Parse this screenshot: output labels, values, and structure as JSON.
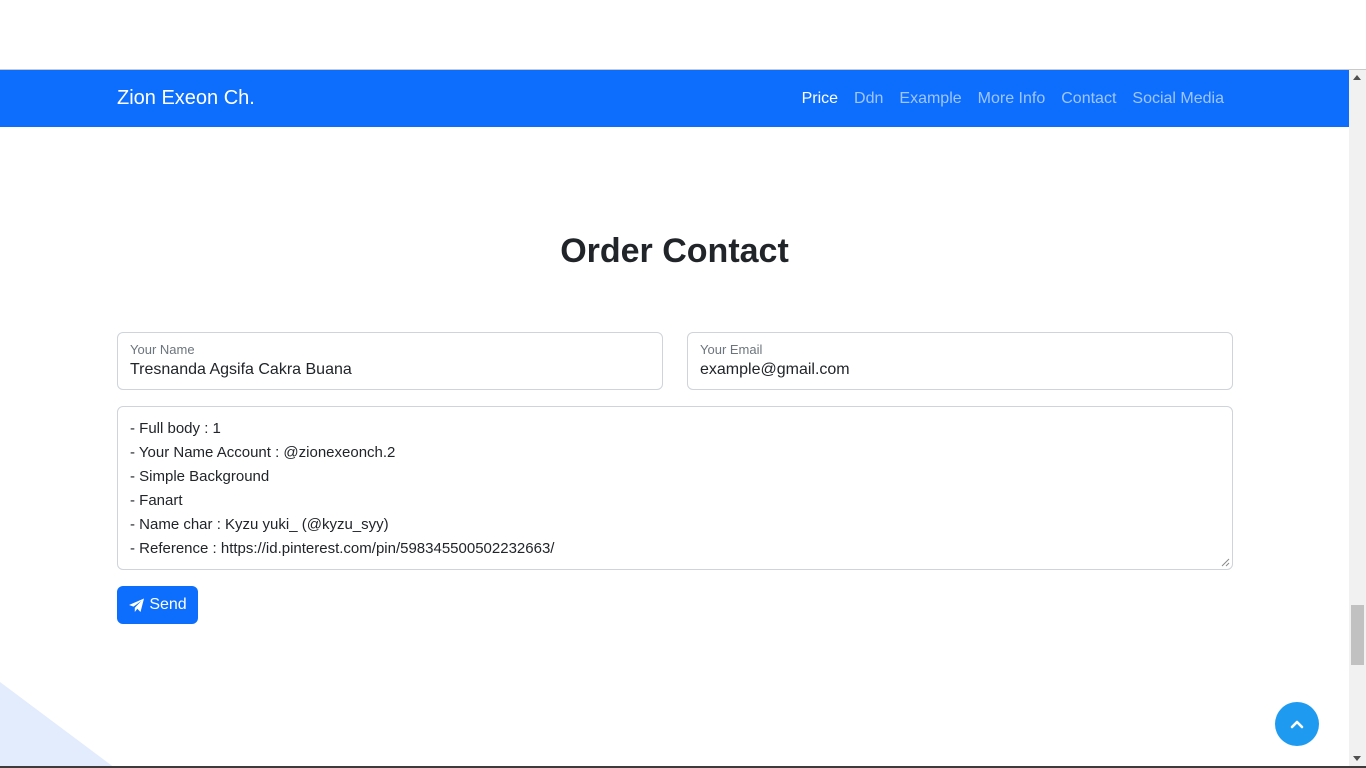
{
  "navbar": {
    "brand": "Zion Exeon Ch.",
    "links": [
      "Price",
      "Ddn",
      "Example",
      "More Info",
      "Contact",
      "Social Media"
    ],
    "active_link": "Price"
  },
  "form": {
    "title": "Order Contact",
    "name_label": "Your Name",
    "name_value": "Tresnanda Agsifa Cakra Buana",
    "email_label": "Your Email",
    "email_value": "example@gmail.com",
    "message_lines": [
      "- Full body : 1",
      "- Your Name Account : @zionexeonch.2",
      "- Simple Background",
      "- Fanart",
      "- Name char : Kyzu yuki_ (@kyzu_syy)",
      "- Reference : https://id.pinterest.com/pin/598345500502232663/"
    ],
    "send_label": "Send"
  },
  "icons": {
    "send": "paper-plane-icon",
    "scroll_top": "chevron-up-icon"
  },
  "colors": {
    "primary": "#0d6efd",
    "scroll_top_button": "#1e9bf0",
    "text": "#212529",
    "muted": "#6c757d"
  }
}
